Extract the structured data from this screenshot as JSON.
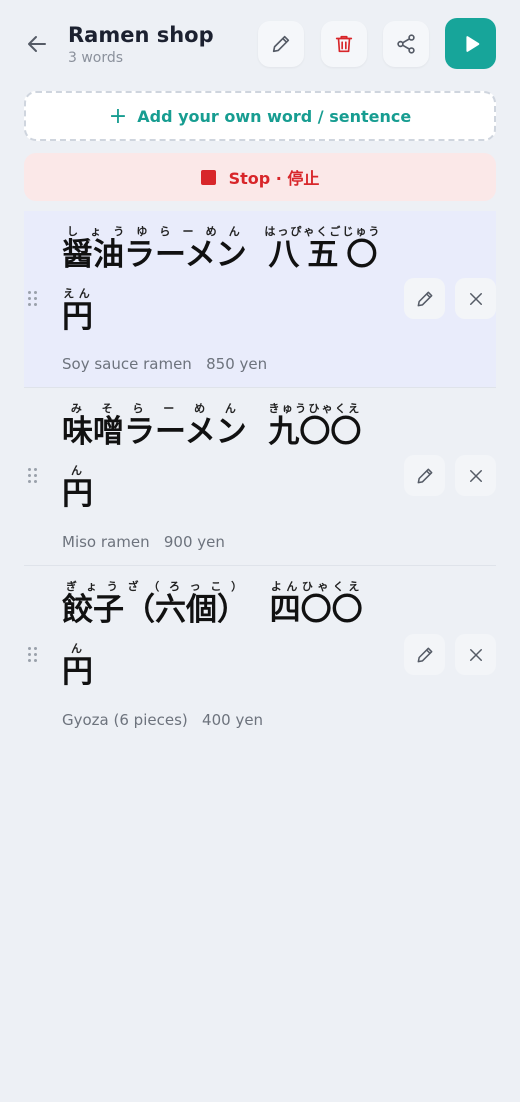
{
  "header": {
    "title": "Ramen shop",
    "subtitle": "3 words",
    "icons": [
      "back-arrow-icon",
      "pencil-icon",
      "trash-icon",
      "share-icon",
      "play-icon"
    ]
  },
  "actions": {
    "add_label": "Add your own word / sentence",
    "stop_label": "Stop · 停止"
  },
  "colors": {
    "accent": "#17a59a",
    "danger": "#d8262a",
    "active_row": "#e9ecfb",
    "background": "#edf0f5"
  },
  "items": [
    {
      "line1_a": "醤油ラーメン",
      "ruby1_a": "しょうゆらーめん",
      "line1_b": "八五〇",
      "ruby1_b": "はっぴゃくごじゅう",
      "line2": "円",
      "ruby2": "えん",
      "translation": "Soy sauce ramen   850 yen"
    },
    {
      "line1_a": "味噌ラーメン",
      "ruby1_a": "みそらーめん",
      "line1_b": "九〇〇",
      "ruby1_b": "きゅうひゃくえ",
      "line2": "円",
      "ruby2": "ん",
      "translation": "Miso ramen   900 yen"
    },
    {
      "line1_a": "餃子（六個）",
      "ruby1_a": "ぎょうざ（ろっこ）",
      "line1_b": "四〇〇",
      "ruby1_b": "よんひゃくえ",
      "line2": "円",
      "ruby2": "ん",
      "translation": "Gyoza (6 pieces)   400 yen"
    }
  ]
}
